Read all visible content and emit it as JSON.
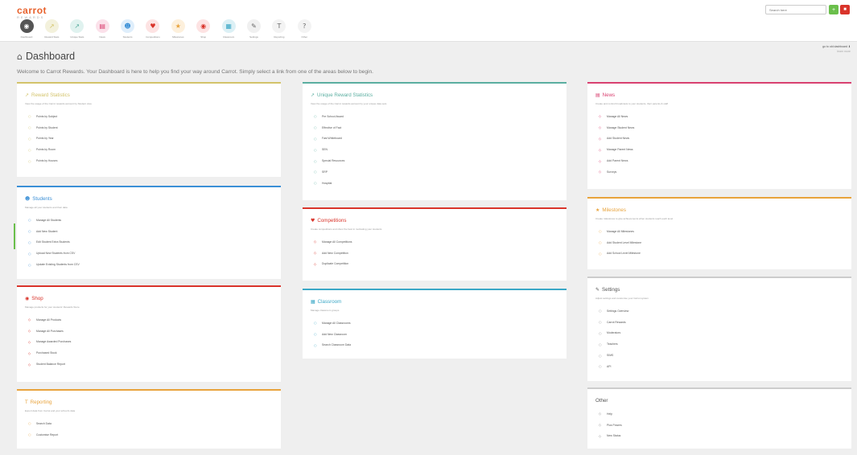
{
  "brand": {
    "name": "carrot",
    "tagline": "REWARDS"
  },
  "colors": {
    "orange": "#e8612c",
    "green": "#6abf4b",
    "blue": "#3a8fd6",
    "pink": "#d94070",
    "yellow": "#e2b54a",
    "red": "#d9342b",
    "gray": "#888888"
  },
  "nav": [
    {
      "label": "Dashboard",
      "icon": "dashboard-icon",
      "glyph": "◉",
      "bg": "#555555",
      "fg": "#ffffff"
    },
    {
      "label": "Reward Stats",
      "icon": "reward-stats-icon",
      "glyph": "↗",
      "bg": "#f3f1dc",
      "fg": "#d3c36a"
    },
    {
      "label": "Unique Stats",
      "icon": "unique-stats-icon",
      "glyph": "↗",
      "bg": "#e0f2ef",
      "fg": "#5aaea0"
    },
    {
      "label": "News",
      "icon": "news-icon",
      "glyph": "▤",
      "bg": "#fbe1ea",
      "fg": "#d94070"
    },
    {
      "label": "Students",
      "icon": "students-icon",
      "glyph": "☻",
      "bg": "#dfeefb",
      "fg": "#3a8fd6"
    },
    {
      "label": "Competitions",
      "icon": "competitions-icon",
      "glyph": "♥",
      "bg": "#fde3e3",
      "fg": "#d9342b"
    },
    {
      "label": "Milestones",
      "icon": "milestones-icon",
      "glyph": "★",
      "bg": "#fdf0dc",
      "fg": "#e8a33c"
    },
    {
      "label": "Shop",
      "icon": "shop-icon",
      "glyph": "◉",
      "bg": "#fde3e3",
      "fg": "#d9342b"
    },
    {
      "label": "Classroom",
      "icon": "classroom-icon",
      "glyph": "▦",
      "bg": "#dcf0f5",
      "fg": "#3aa7c6"
    },
    {
      "label": "Settings",
      "icon": "settings-icon",
      "glyph": "✎",
      "bg": "#f0f0f0",
      "fg": "#666666"
    },
    {
      "label": "Reporting",
      "icon": "reporting-icon",
      "glyph": "T",
      "bg": "#f3f3f3",
      "fg": "#666666"
    },
    {
      "label": "Other",
      "icon": "other-icon",
      "glyph": "?",
      "bg": "#f3f3f3",
      "fg": "#666666"
    }
  ],
  "search": {
    "placeholder": "Search here"
  },
  "top_buttons": {
    "search_glyph": "+",
    "logout_glyph": "■"
  },
  "header": {
    "title": "Dashboard",
    "welcome": "Welcome to Carrot Rewards. Your Dashboard is here to help you find your way around Carrot. Simply select a link from one of the areas below to begin.",
    "top_right": "go to old dashboard ⬇",
    "top_right_sub": "learn more"
  },
  "cards": {
    "reward_stats": {
      "title": "Reward Statistics",
      "icon": "chart-icon",
      "glyph": "↗",
      "desc": "View the usage of the Carrot rewards account by Student view",
      "items": [
        "Points by Subject",
        "Points by Student",
        "Points by Year",
        "Points by Room",
        "Points by Houses"
      ],
      "bullet": "○"
    },
    "unique_stats": {
      "title": "Unique Reward Statistics",
      "icon": "chart-icon",
      "glyph": "↗",
      "desc": "View the usage of the Carrot rewards account by your unique data sets",
      "items": [
        "Pre School Award",
        "Effective of Fact",
        "Fast Whiteboard",
        "SEN",
        "Special Resources",
        "SRP",
        "Hospital"
      ],
      "bullet": "○"
    },
    "news": {
      "title": "News",
      "icon": "news-icon",
      "glyph": "▤",
      "desc": "Create and control broadcasts to your students, their parents & staff",
      "items": [
        "Manage All News",
        "Manage Student News",
        "Add Student News",
        "Manage Parent News",
        "Add Parent News",
        "Surveys"
      ],
      "bullet": "◇"
    },
    "students": {
      "title": "Students",
      "icon": "students-icon",
      "glyph": "☻",
      "desc": "Manage all your students and their data",
      "items": [
        "Manage All Students",
        "Add New Student",
        "Edit Student Extra Students",
        "Upload New Students from CSV",
        "Update Existing Students from CSV"
      ],
      "bullet": "○"
    },
    "competitions": {
      "title": "Competitions",
      "icon": "trophy-icon",
      "glyph": "♥",
      "desc": "Create competitions and show the best in motivating your students",
      "items": [
        "Manage All Competitions",
        "Add New Competition",
        "Duplicate Competition"
      ],
      "bullet": "◇"
    },
    "milestones": {
      "title": "Milestones",
      "icon": "star-icon",
      "glyph": "★",
      "desc": "Create milestones to give achievements when students reach each level",
      "items": [
        "Manage All Milestones",
        "Add Student Level Milestone",
        "Add School Level Milestone"
      ],
      "bullet": "○"
    },
    "shop": {
      "title": "Shop",
      "icon": "shop-icon",
      "glyph": "◉",
      "desc": "Manage products for your students' Rewards Store",
      "items": [
        "Manage All Products",
        "Manage All Purchases",
        "Manage Awarded Purchases",
        "Purchased Stock",
        "Student Balance Report"
      ],
      "bullet": "◇"
    },
    "classroom": {
      "title": "Classroom",
      "icon": "classroom-icon",
      "glyph": "▦",
      "desc": "Manage classroom groups",
      "items": [
        "Manage All Classrooms",
        "Add New Classroom",
        "Search Classroom Data"
      ],
      "bullet": "○"
    },
    "settings": {
      "title": "Settings",
      "icon": "wrench-icon",
      "glyph": "✎",
      "desc": "Adjust settings and customise your Carrot system",
      "items": [
        "Settings Overview",
        "Carrot Rewards",
        "Moderators",
        "Teachers",
        "SIMS",
        "API"
      ],
      "bullet": "○"
    },
    "reporting": {
      "title": "Reporting",
      "icon": "filter-icon",
      "glyph": "T",
      "desc": "Export data from Carrot and your school's data",
      "items": [
        "Search Data",
        "Customise Report"
      ],
      "bullet": "○"
    },
    "other": {
      "title": "Other",
      "icon": "",
      "glyph": "",
      "desc": "",
      "items": [
        "Help",
        "Plus Powers",
        "New Status"
      ],
      "bullet": "◇"
    }
  }
}
